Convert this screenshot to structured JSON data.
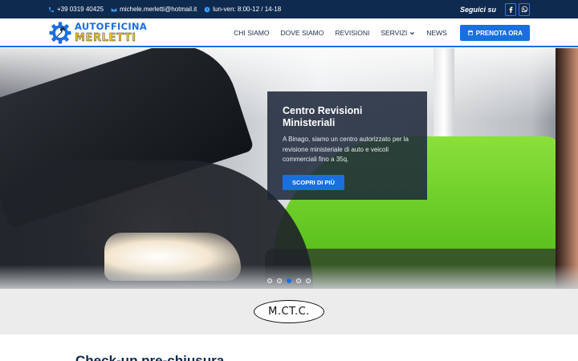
{
  "topbar": {
    "phone": "+39 0319 40425",
    "email": "michele.merletti@hotmail.it",
    "hours": "lun-ven: 8:00-12 / 14-18",
    "follow_label": "Seguici su",
    "social": [
      {
        "icon": "facebook-icon"
      },
      {
        "icon": "whatsapp-icon"
      }
    ]
  },
  "logo": {
    "line1": "AUTOFFICINA",
    "line2": "MERLETTI",
    "icon": "gear-wrench-icon"
  },
  "nav": {
    "items": [
      "CHI SIAMO",
      "DOVE SIAMO",
      "REVISIONI",
      "SERVIZI",
      "NEWS"
    ],
    "book_label": "PRENOTA ORA"
  },
  "hero": {
    "title": "Centro Revisioni Ministeriali",
    "text": "A Binago, siamo un centro autorizzato per la revisione ministeriale di auto e veicoli commerciali fino a 35q.",
    "button": "SCOPRI DI PIÙ",
    "slides_total": 5,
    "slide_active": 3
  },
  "band": {
    "logo_text": "M.CT.C."
  },
  "section": {
    "title": "Check-up pre-chiusura"
  },
  "colors": {
    "topbar": "#0f2a4f",
    "accent": "#1a6fe0",
    "logo_yellow": "#f4c51f",
    "band": "#ececec"
  }
}
